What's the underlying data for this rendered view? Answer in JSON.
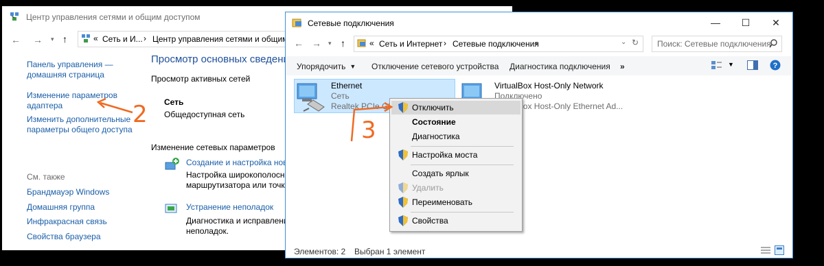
{
  "back_window": {
    "title": "Центр управления сетями и общим доступом",
    "breadcrumb": [
      "Сеть и И...",
      "Центр управления сетями и общим д"
    ],
    "sidebar": {
      "home_line1": "Панель управления —",
      "home_line2": "домашняя страница",
      "adapter_line1": "Изменение параметров",
      "adapter_line2": "адаптера",
      "sharing_line1": "Изменить дополнительные",
      "sharing_line2": "параметры общего доступа",
      "see_also": "См. также",
      "links": [
        "Брандмауэр Windows",
        "Домашняя группа",
        "Инфракрасная связь",
        "Свойства браузера"
      ]
    },
    "main": {
      "heading": "Просмотр основных сведени",
      "active_networks": "Просмотр активных сетей",
      "network_name": "Сеть",
      "network_type": "Общедоступная сеть",
      "change_settings": "Изменение сетевых параметров",
      "create_link": "Создание и настройка ново",
      "create_desc1": "Настройка широкополосно",
      "create_desc2": "маршрутизатора или точки",
      "troubleshoot_link": "Устранение неполадок",
      "troubleshoot_desc1": "Диагностика и исправление",
      "troubleshoot_desc2": "неполадок."
    }
  },
  "front_window": {
    "title": "Сетевые подключения",
    "breadcrumb": [
      "Сеть и Интернет",
      "Сетевые подключения"
    ],
    "search_placeholder": "Поиск: Сетевые подключения",
    "toolbar": {
      "organize": "Упорядочить",
      "disable": "Отключение сетевого устройства",
      "diagnose": "Диагностика подключения",
      "more": "»"
    },
    "adapters": [
      {
        "name": "Ethernet",
        "status": "Сеть",
        "device": "Realtek PCIe GB"
      },
      {
        "name": "VirtualBox Host-Only Network",
        "status": "Подключено",
        "device": "VirtualBox Host-Only Ethernet Ad..."
      }
    ],
    "statusbar": {
      "items": "Элементов: 2",
      "selected": "Выбран 1 элемент"
    }
  },
  "context_menu": [
    {
      "label": "Отключить",
      "shield": true,
      "bold": false,
      "disabled": false
    },
    {
      "label": "Состояние",
      "shield": false,
      "bold": true,
      "disabled": false
    },
    {
      "label": "Диагностика",
      "shield": false,
      "bold": false,
      "disabled": false
    },
    {
      "label": "Настройка моста",
      "shield": true,
      "bold": false,
      "disabled": false
    },
    {
      "label": "Создать ярлык",
      "shield": false,
      "bold": false,
      "disabled": false
    },
    {
      "label": "Удалить",
      "shield": true,
      "bold": false,
      "disabled": true
    },
    {
      "label": "Переименовать",
      "shield": true,
      "bold": false,
      "disabled": false
    },
    {
      "label": "Свойства",
      "shield": true,
      "bold": false,
      "disabled": false
    }
  ],
  "annotations": {
    "step2": "2",
    "step3": "3"
  },
  "colors": {
    "accent": "#1a5ea8",
    "annotation": "#f06a22",
    "selection": "#cce8ff",
    "menu_hover": "#d8d8d8"
  }
}
